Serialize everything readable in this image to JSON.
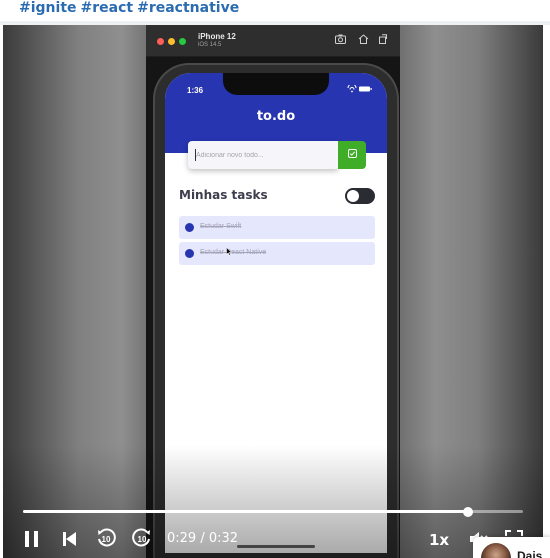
{
  "hashtags": [
    "#ignite",
    "#react",
    "#reactnative"
  ],
  "simulator": {
    "device_name": "iPhone 12",
    "os_version": "iOS 14.5",
    "toolbar_icons": [
      "screenshot-icon",
      "home-icon",
      "rotate-icon"
    ]
  },
  "app": {
    "status_time": "1:36",
    "logo": "to.do",
    "input_placeholder": "Adicionar novo todo...",
    "section_title": "Minhas tasks",
    "tasks": [
      {
        "label": "Estudar Swift",
        "done": true
      },
      {
        "label": "Estudar React Native",
        "done": true
      }
    ],
    "colors": {
      "header": "#2735b1",
      "add_button": "#3fad27",
      "task_bg": "#e5e7fc"
    }
  },
  "player": {
    "current_time": "0:29",
    "separator": "/",
    "duration": "0:32",
    "progress_fraction": 0.89,
    "speed": "1x",
    "rewind_label": "10",
    "forward_label": "10"
  },
  "author": {
    "name": "Dais"
  }
}
